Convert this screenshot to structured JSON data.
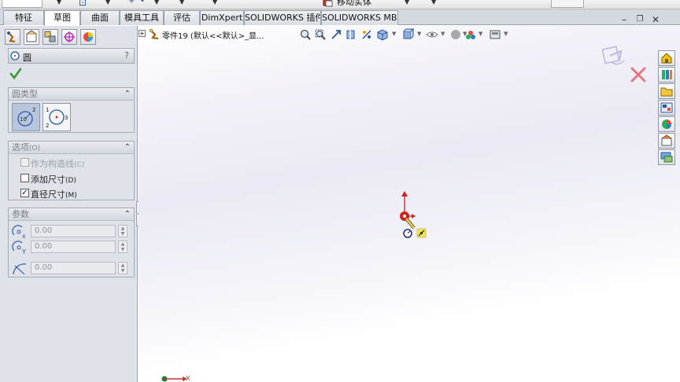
{
  "toolbar": {
    "move_body_label": "移动实体",
    "icons": [
      "sketch-line-icon",
      "smart-dimension-icon",
      "move-body-icon"
    ]
  },
  "tabs": [
    {
      "label": "特征",
      "active": false
    },
    {
      "label": "草图",
      "active": true
    },
    {
      "label": "曲面",
      "active": false
    },
    {
      "label": "模具工具",
      "active": false
    },
    {
      "label": "评估",
      "active": false
    },
    {
      "label": "DimXpert",
      "active": false
    },
    {
      "label": "SOLIDWORKS 插件",
      "active": false
    },
    {
      "label": "SOLIDWORKS MBD",
      "active": false
    }
  ],
  "window_buttons": [
    "minimize",
    "restore",
    "close"
  ],
  "property_manager": {
    "panel_tabs": [
      "feature-manager-icon",
      "property-manager-icon",
      "configuration-manager-icon",
      "dimxpert-manager-icon",
      "display-manager-icon"
    ],
    "title": "圆",
    "help": "?",
    "circle_type": {
      "header": "圆类型",
      "options": [
        {
          "name": "center-circle",
          "selected": true,
          "labels": [
            "10",
            "2"
          ]
        },
        {
          "name": "perimeter-circle",
          "selected": false,
          "labels": [
            "1",
            "2",
            "3"
          ]
        }
      ]
    },
    "options": {
      "header": "选项",
      "header_shortcut": "(O)",
      "items": [
        {
          "label": "作为构造线",
          "shortcut": "(C)",
          "checked": false,
          "disabled": true
        },
        {
          "label": "添加尺寸",
          "shortcut": "(D)",
          "checked": false,
          "disabled": false
        },
        {
          "label": "直径尺寸",
          "shortcut": "(M)",
          "checked": true,
          "disabled": false
        }
      ]
    },
    "parameters": {
      "header": "参数",
      "rows": [
        {
          "icon": "center-x-icon",
          "sub": "x",
          "value": "0.00"
        },
        {
          "icon": "center-y-icon",
          "sub": "Y",
          "value": "0.00"
        },
        {
          "icon": "radius-icon",
          "sub": "",
          "value": "0.00"
        }
      ]
    }
  },
  "feature_tree": {
    "expand": "+",
    "part_label": "零件19",
    "config_label": "(默认<<默认>_显..."
  },
  "heads_up_toolbar": [
    "zoom-to-fit-icon",
    "zoom-area-icon",
    "previous-view-icon",
    "section-view-icon",
    "dynamic-annotation-icon",
    "view-orientation-icon",
    "display-style-icon",
    "hide-show-items-icon",
    "edit-appearance-icon",
    "apply-scene-icon",
    "view-settings-icon"
  ],
  "confirmation_corner": [
    "exit-sketch-icon",
    "cancel-sketch-icon"
  ],
  "task_pane": [
    "home-icon",
    "design-library-icon",
    "file-explorer-icon",
    "view-palette-icon",
    "appearances-icon",
    "custom-properties-icon",
    "forum-icon"
  ],
  "triad": {
    "axis_label": "X"
  },
  "colors": {
    "accent_blue": "#2a57a5",
    "cancel_red": "#e0383e",
    "origin_red": "#d21f1f",
    "check_green": "#2e9b2e"
  }
}
